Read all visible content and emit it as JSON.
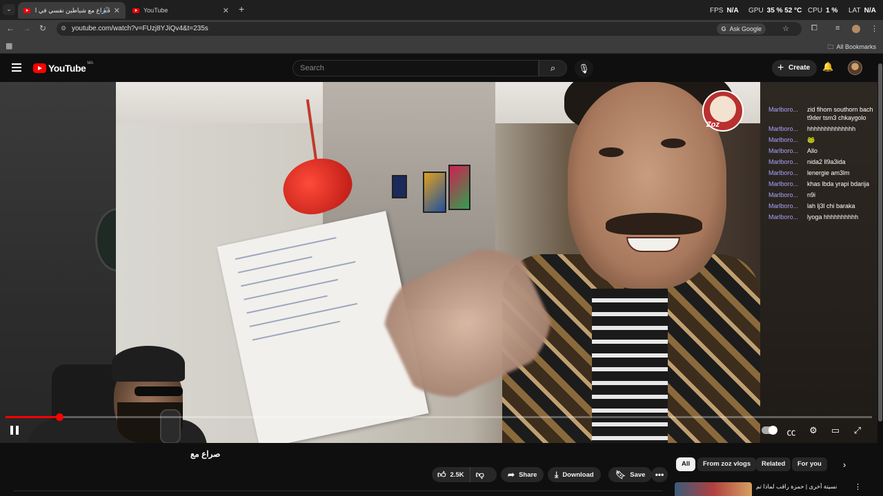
{
  "browser": {
    "tabs": [
      {
        "title": "صراع مع شياطين نفسي في ال",
        "active": true
      },
      {
        "title": "YouTube",
        "active": false
      }
    ],
    "new_tab_label": "+",
    "perf": {
      "fps_label": "FPS",
      "fps_value": "N/A",
      "gpu_label": "GPU",
      "gpu_value": "35 % 52 °C",
      "cpu_label": "CPU",
      "cpu_value": "1 %",
      "lat_label": "LAT",
      "lat_value": "N/A"
    },
    "url": "youtube.com/watch?v=FUzj8YJiQv4&t=235s",
    "ask_google": "Ask Google",
    "all_bookmarks": "All Bookmarks"
  },
  "youtube": {
    "logo_text": "YouTube",
    "country_code": "MA",
    "search_placeholder": "Search",
    "create_label": "Create"
  },
  "player": {
    "progress_fraction": 0.062,
    "channel_watermark": "Zoz",
    "live_chat": [
      {
        "author": "Marlboro...",
        "text": "zid fihom southorn bach"
      },
      {
        "author": "",
        "text": "t9der tsm3 chkaygolo"
      },
      {
        "author": "Marlboro...",
        "text": "hhhhhhhhhhhhhh"
      },
      {
        "author": "Marlboro...",
        "text": "🐸"
      },
      {
        "author": "Marlboro...",
        "text": "Allo"
      },
      {
        "author": "Marlboro...",
        "text": "nida2 ll9a3ida"
      },
      {
        "author": "Marlboro...",
        "text": "lenergie am3lm"
      },
      {
        "author": "Marlboro...",
        "text": "khas lbda yrapi bdarija"
      },
      {
        "author": "Marlboro...",
        "text": "n9i"
      },
      {
        "author": "Marlboro...",
        "text": "lah lj3l chi baraka"
      },
      {
        "author": "Marlboro...",
        "text": "lyoga hhhhhhhhhh"
      }
    ]
  },
  "video": {
    "title": "صراع مع",
    "likes": "2.5K",
    "share_label": "Share",
    "download_label": "Download",
    "save_label": "Save"
  },
  "filters": {
    "chips": [
      "All",
      "From zoz vlogs",
      "Related",
      "For you"
    ]
  },
  "recommendation": {
    "title": "نسيتة أخرى | حمزة راقب لماذا تم"
  },
  "colors": {
    "accent": "#ff0000",
    "chat_author": "#a9a4ff",
    "background": "#0f0f0f"
  }
}
